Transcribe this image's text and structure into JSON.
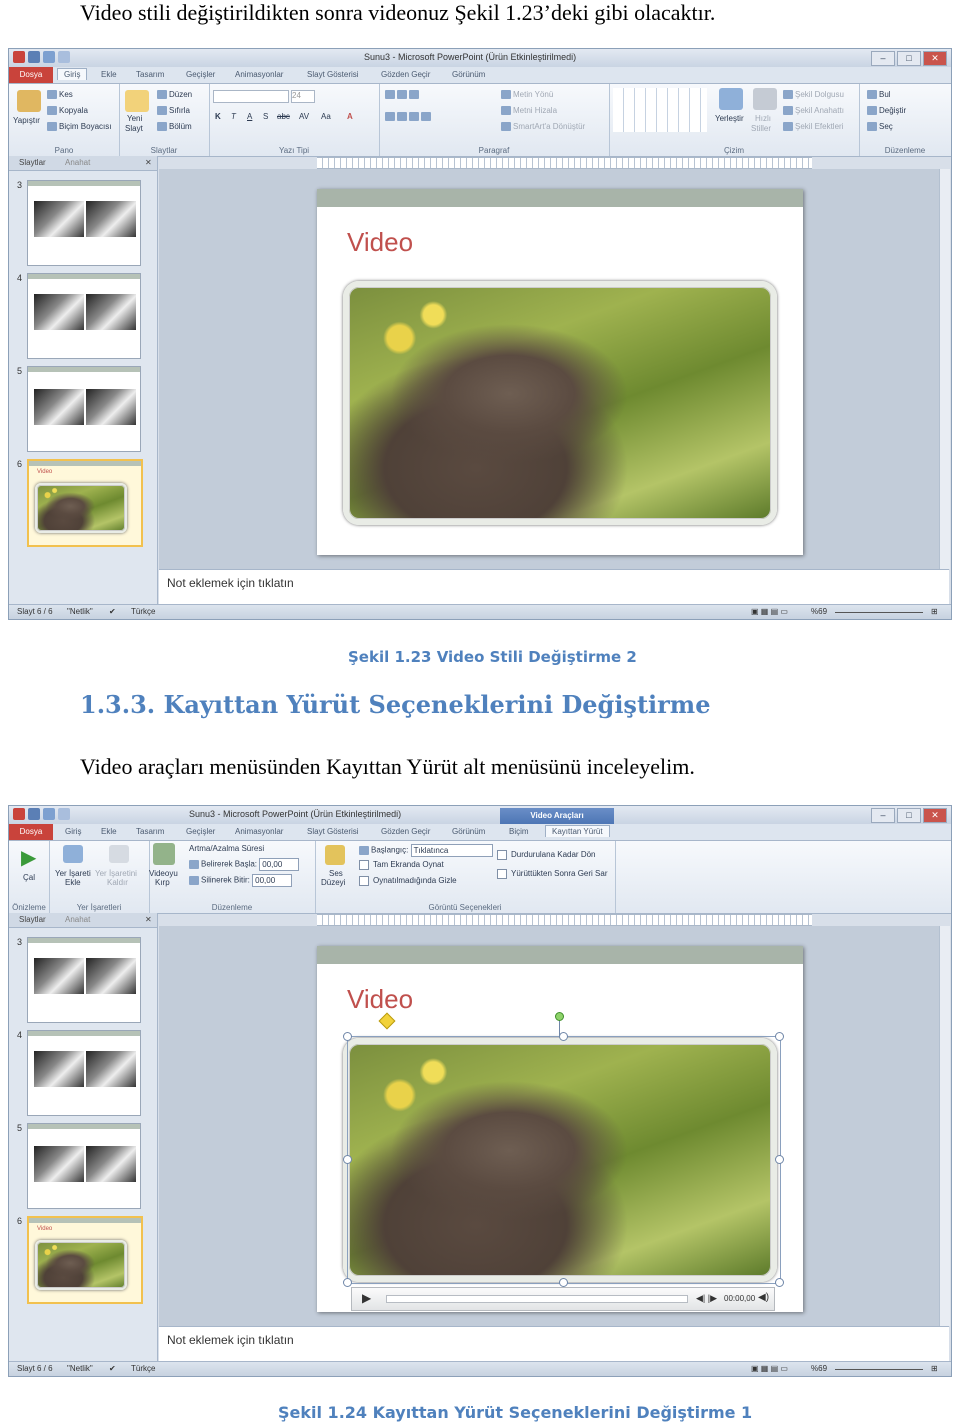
{
  "doc": {
    "intro_text": "Video stili değiştirildikten sonra videonuz Şekil 1.23’deki gibi olacaktır.",
    "caption1": "Şekil 1.23 Video Stili Değiştirme 2",
    "section_heading": "1.3.3. Kayıttan Yürüt Seçeneklerini Değiştirme",
    "body_text": "Video araçları menüsünden Kayıttan Yürüt alt menüsünü inceleyelim.",
    "caption2": "Şekil 1.24 Kayıttan Yürüt Seçeneklerini Değiştirme 1"
  },
  "app": {
    "window_title": "Sunu3 - Microsoft PowerPoint (Ürün Etkinleştirilmedi)",
    "tabs": [
      "Dosya",
      "Giriş",
      "Ekle",
      "Tasarım",
      "Geçişler",
      "Animasyonlar",
      "Slayt Gösterisi",
      "Gözden Geçir",
      "Görünüm"
    ],
    "panel_tabs": [
      "Slaytlar",
      "Anahat"
    ],
    "slide_numbers": [
      "3",
      "4",
      "5",
      "6"
    ],
    "thumb_captions": [
      "Video"
    ],
    "slide_title": "Video",
    "notes_placeholder": "Not eklemek için tıklatın",
    "status_slide": "Slayt 6 / 6",
    "status_theme": "\"Netlik\"",
    "status_lang": "Türkçe",
    "zoom": "%69"
  },
  "ribbon_home": {
    "groups": [
      "Pano",
      "Slaytlar",
      "Yazı Tipi",
      "Paragraf",
      "Çizim",
      "Düzenleme"
    ],
    "paste": "Yapıştır",
    "cut": "Kes",
    "copy": "Kopyala",
    "format_painter": "Biçim Boyacısı",
    "new_slide_1": "Yeni",
    "new_slide_2": "Slayt",
    "layout": "Düzen",
    "reset": "Sıfırla",
    "section": "Bölüm",
    "font_size": "24",
    "font_k": "K",
    "font_t": "T",
    "font_a": "A",
    "font_s": "S",
    "font_abe": "abc",
    "font_av": "AV",
    "font_aa": "Aa",
    "text_dir": "Metin Yönü",
    "align_text": "Metni Hizala",
    "smartart": "SmartArt'a Dönüştür",
    "arrange": "Yerleştir",
    "quick_styles_1": "Hızlı",
    "quick_styles_2": "Stiller",
    "shape_fill": "Şekil Dolgusu",
    "shape_outline": "Şekil Anahattı",
    "shape_effects": "Şekil Efektleri",
    "find": "Bul",
    "replace": "Değiştir",
    "select": "Seç"
  },
  "ribbon_video": {
    "context_header": "Video Araçları",
    "context_tabs": [
      "Biçim",
      "Kayıttan Yürüt"
    ],
    "groups": [
      "Önizleme",
      "Yer İşaretleri",
      "Düzenleme",
      "Görüntü Seçenekleri"
    ],
    "play": "Çal",
    "add_bookmark_1": "Yer İşareti",
    "add_bookmark_2": "Ekle",
    "remove_bookmark_1": "Yer İşaretini",
    "remove_bookmark_2": "Kaldır",
    "trim_1": "Videoyu",
    "trim_2": "Kırp",
    "fade_duration": "Artma/Azalma Süresi",
    "fade_in_label": "Belirerek Başla:",
    "fade_in_value": "00,00",
    "fade_out_label": "Silinerek Bitir:",
    "fade_out_value": "00,00",
    "volume_1": "Ses",
    "volume_2": "Düzeyi",
    "start_label": "Başlangıç:",
    "start_value": "Tıklatınca",
    "play_fullscreen": "Tam Ekranda Oynat",
    "hide_not_playing": "Oynatılmadığında Gizle",
    "loop": "Durdurulana Kadar Dön",
    "rewind": "Yürüttükten Sonra Geri Sar",
    "player_time": "00:00,00"
  },
  "colors": {
    "accent_heading": "#4f81bd",
    "file_tab": "#c9433b",
    "slide_title": "#c0504d"
  }
}
